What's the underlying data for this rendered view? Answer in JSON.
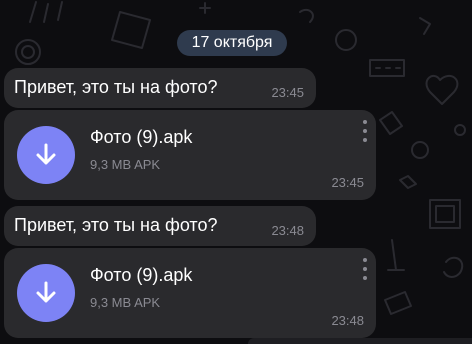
{
  "date_separator": "17 октября",
  "messages": [
    {
      "type": "text",
      "text": "Привет, это ты на фото?",
      "time": "23:45"
    },
    {
      "type": "file",
      "file_name": "Фото (9).apk",
      "file_meta": "9,3 MB APK",
      "time": "23:45",
      "icon": "download-icon"
    },
    {
      "type": "text",
      "text": "Привет, это ты на фото?",
      "time": "23:48"
    },
    {
      "type": "file",
      "file_name": "Фото (9).apk",
      "file_meta": "9,3 MB APK",
      "time": "23:48",
      "icon": "download-icon"
    }
  ],
  "colors": {
    "background": "#0d0d10",
    "bubble": "#2a2a2d",
    "date_chip": "#2f3b4e",
    "file_icon": "#7d83f5",
    "meta_text": "#8a8a92"
  }
}
